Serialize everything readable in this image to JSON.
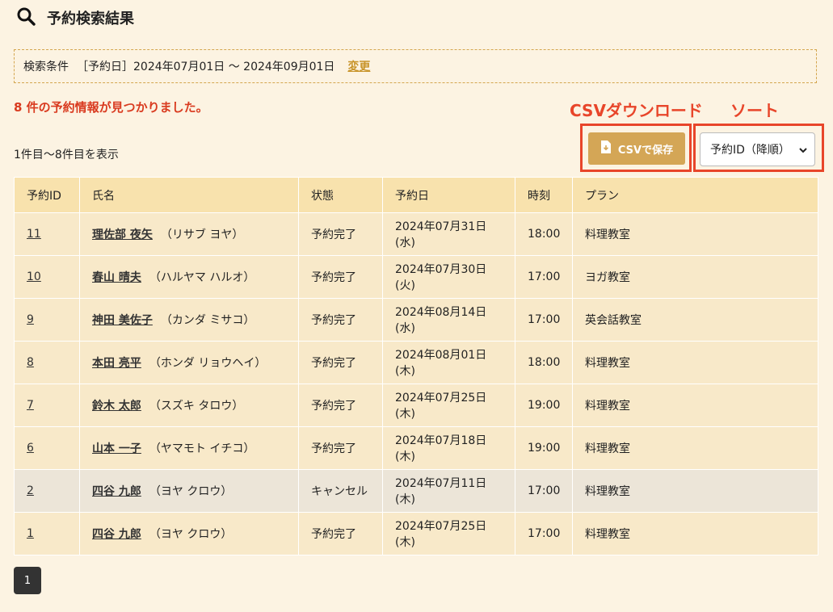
{
  "header": {
    "title": "予約検索結果"
  },
  "condition": {
    "label": "検索条件",
    "value": "［予約日］2024年07月01日 〜 2024年09月01日",
    "change_label": "変更"
  },
  "result_message": "8 件の予約情報が見つかりました。",
  "annotations": {
    "csv": "CSVダウンロード",
    "sort": "ソート",
    "color": "#e8452a"
  },
  "toolbar": {
    "csv_label": "CSVで保存",
    "sort_selected": "予約ID（降順）"
  },
  "range_label": "1件目〜8件目を表示",
  "table": {
    "headers": [
      "予約ID",
      "氏名",
      "状態",
      "予約日",
      "時刻",
      "プラン"
    ],
    "rows": [
      {
        "id": "11",
        "name": "理佐部 夜矢",
        "kana": "（リサブ ヨヤ）",
        "status": "予約完了",
        "date": "2024年07月31日(水)",
        "time": "18:00",
        "plan": "料理教室"
      },
      {
        "id": "10",
        "name": "春山 晴夫",
        "kana": "（ハルヤマ ハルオ）",
        "status": "予約完了",
        "date": "2024年07月30日(火)",
        "time": "17:00",
        "plan": "ヨガ教室"
      },
      {
        "id": "9",
        "name": "神田 美佐子",
        "kana": "（カンダ ミサコ）",
        "status": "予約完了",
        "date": "2024年08月14日(水)",
        "time": "17:00",
        "plan": "英会話教室"
      },
      {
        "id": "8",
        "name": "本田 亮平",
        "kana": "（ホンダ リョウヘイ）",
        "status": "予約完了",
        "date": "2024年08月01日(木)",
        "time": "18:00",
        "plan": "料理教室"
      },
      {
        "id": "7",
        "name": "鈴木 太郎",
        "kana": "（スズキ タロウ）",
        "status": "予約完了",
        "date": "2024年07月25日(木)",
        "time": "19:00",
        "plan": "料理教室"
      },
      {
        "id": "6",
        "name": "山本 一子",
        "kana": "（ヤマモト イチコ）",
        "status": "予約完了",
        "date": "2024年07月18日(木)",
        "time": "19:00",
        "plan": "料理教室"
      },
      {
        "id": "2",
        "name": "四谷 九郎",
        "kana": "（ヨヤ クロウ）",
        "status": "キャンセル",
        "date": "2024年07月11日(木)",
        "time": "17:00",
        "plan": "料理教室"
      },
      {
        "id": "1",
        "name": "四谷 九郎",
        "kana": "（ヨヤ クロウ）",
        "status": "予約完了",
        "date": "2024年07月25日(木)",
        "time": "17:00",
        "plan": "料理教室"
      }
    ]
  },
  "pagination": {
    "current": "1"
  },
  "icons": {
    "search": "search-icon",
    "csv": "file-download-icon",
    "sort": "chevron-down-icon"
  },
  "colors": {
    "background": "#fcf3e2",
    "accent": "#d4a656",
    "header_row": "#f8e2ad",
    "row": "#f8e9c9",
    "cancel_row": "#ece5d8",
    "result_text": "#d93a1f"
  }
}
